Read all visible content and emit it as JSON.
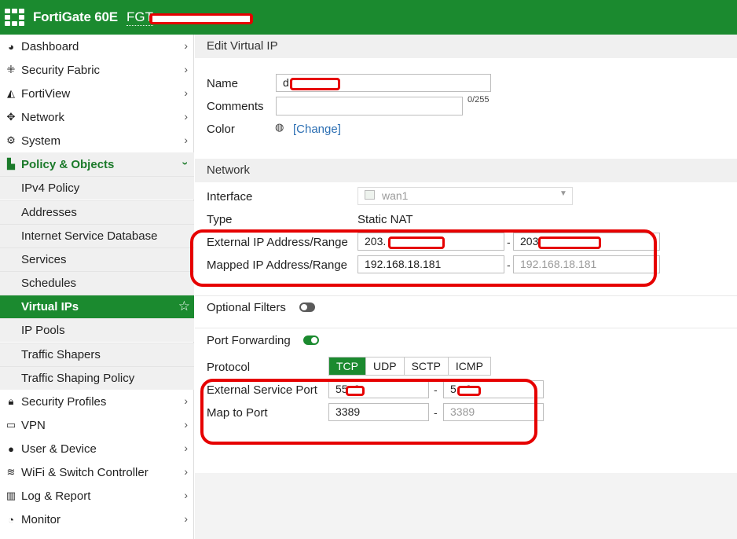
{
  "header": {
    "brand": "FortiGate 60E",
    "hostname": "FGT"
  },
  "sidebar": {
    "items": [
      {
        "label": "Dashboard",
        "icon": "dashboard-icon"
      },
      {
        "label": "Security Fabric",
        "icon": "security-fabric-icon"
      },
      {
        "label": "FortiView",
        "icon": "fortiview-icon"
      },
      {
        "label": "Network",
        "icon": "network-icon"
      },
      {
        "label": "System",
        "icon": "gear-icon"
      },
      {
        "label": "Policy & Objects",
        "icon": "policy-icon"
      }
    ],
    "sub_items": [
      {
        "label": "IPv4 Policy"
      },
      {
        "label": "Addresses"
      },
      {
        "label": "Internet Service Database"
      },
      {
        "label": "Services"
      },
      {
        "label": "Schedules"
      },
      {
        "label": "Virtual IPs"
      },
      {
        "label": "IP Pools"
      },
      {
        "label": "Traffic Shapers"
      },
      {
        "label": "Traffic Shaping Policy"
      }
    ],
    "items_after": [
      {
        "label": "Security Profiles",
        "icon": "lock-icon"
      },
      {
        "label": "VPN",
        "icon": "vpn-icon"
      },
      {
        "label": "User & Device",
        "icon": "user-icon"
      },
      {
        "label": "WiFi & Switch Controller",
        "icon": "wifi-icon"
      },
      {
        "label": "Log & Report",
        "icon": "chart-icon"
      },
      {
        "label": "Monitor",
        "icon": "monitor-icon"
      }
    ]
  },
  "form": {
    "title": "Edit Virtual IP",
    "name_label": "Name",
    "name_value": "d",
    "comments_label": "Comments",
    "comments_count": "0/255",
    "color_label": "Color",
    "color_change": "[Change]",
    "network_title": "Network",
    "interface_label": "Interface",
    "interface_value": "wan1",
    "type_label": "Type",
    "type_value": "Static NAT",
    "ext_ip_label": "External IP Address/Range",
    "ext_ip_start": "203.",
    "ext_ip_end": "203",
    "mapped_ip_label": "Mapped IP Address/Range",
    "mapped_ip_start": "192.168.18.181",
    "mapped_ip_end": "192.168.18.181",
    "optional_filters_label": "Optional Filters",
    "optional_filters_on": false,
    "port_forwarding_label": "Port Forwarding",
    "port_forwarding_on": true,
    "protocol_label": "Protocol",
    "protocols": [
      "TCP",
      "UDP",
      "SCTP",
      "ICMP"
    ],
    "protocol_selected": "TCP",
    "ext_port_label": "External Service Port",
    "ext_port_start": "55  0",
    "ext_port_end": "5   0",
    "map_port_label": "Map to Port",
    "map_port_start": "3389",
    "map_port_end": "3389",
    "dash": "-"
  },
  "colors": {
    "brand_green": "#1b8a2f",
    "annotation_red": "#e60000"
  }
}
